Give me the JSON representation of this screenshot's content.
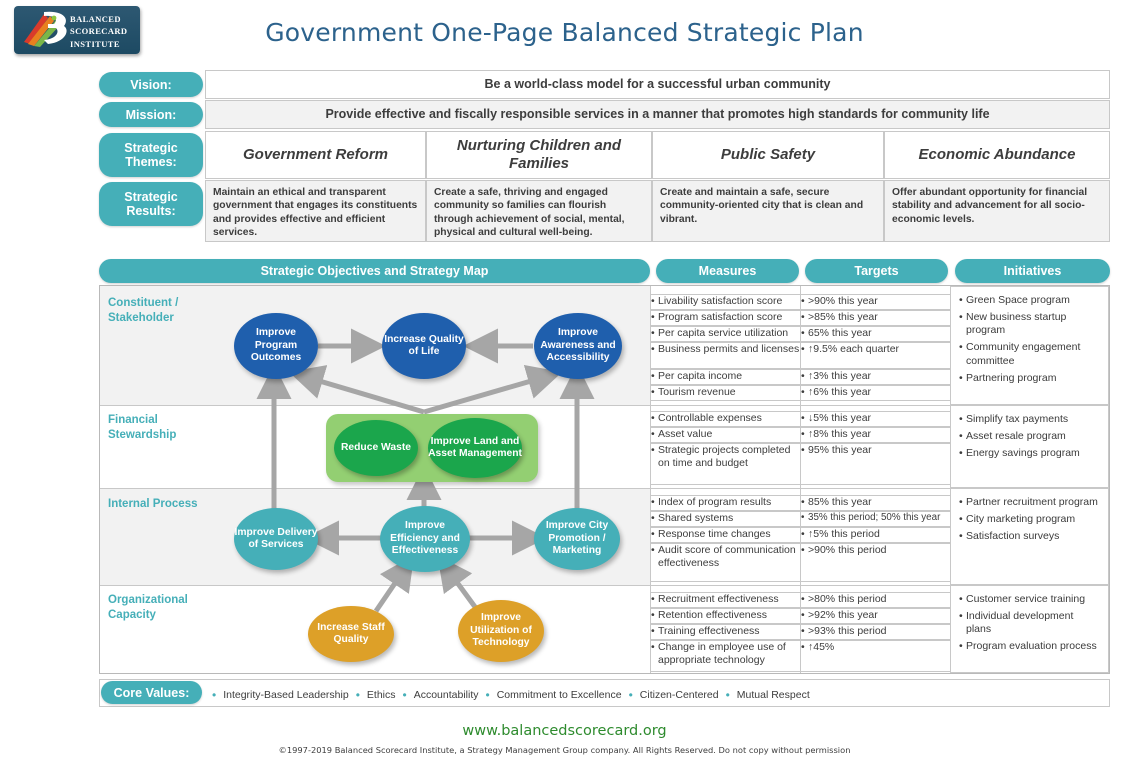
{
  "page": {
    "title": "Government One-Page Balanced Strategic Plan",
    "logo_lines": [
      "BALANCED",
      "SCORECARD",
      "INSTITUTE"
    ],
    "url": "www.balancedscorecard.org",
    "copyright": "©1997-2019 Balanced Scorecard Institute, a Strategy Management Group company. All Rights Reserved. Do not copy without permission"
  },
  "colors": {
    "teal": "#45afb8",
    "title_blue": "#2c628c",
    "blue_oval": "#1f5fad",
    "green_oval": "#1ba64c",
    "green_box": "#93cf72",
    "teal_oval": "#45afb8",
    "orange_oval": "#dda028",
    "url_green": "#2e8b2e"
  },
  "header": {
    "vision_label": "Vision:",
    "vision_text": "Be a world-class model for a successful urban community",
    "mission_label": "Mission:",
    "mission_text": "Provide effective and fiscally responsible services in a manner that promotes high standards for community life",
    "themes_label": "Strategic Themes:",
    "results_label": "Strategic Results:",
    "themes": [
      "Government Reform",
      "Nurturing Children and Families",
      "Public Safety",
      "Economic Abundance"
    ],
    "results": [
      "Maintain an ethical and transparent government that engages its constituents and provides effective and efficient services.",
      "Create a safe, thriving and engaged community so families can flourish through achievement of social, mental, physical and cultural well-being.",
      "Create and maintain a safe, secure community-oriented city that is clean and vibrant.",
      "Offer abundant opportunity for financial stability and advancement for all socio-economic levels."
    ]
  },
  "columns": {
    "strategy_map": "Strategic  Objectives  and  Strategy  Map",
    "measures": "Measures",
    "targets": "Targets",
    "initiatives": "Initiatives"
  },
  "perspectives": [
    {
      "name": "Constituent / Stakeholder",
      "objectives": [
        "Improve Program Outcomes",
        "Increase Quality of Life",
        "Improve Awareness and Accessibility"
      ],
      "measures": [
        "Livability satisfaction score",
        "Program satisfaction score",
        "Per capita service utilization",
        "Business permits and licenses",
        "Per capita income",
        "Tourism revenue"
      ],
      "targets": [
        ">90% this year",
        ">85% this year",
        "65% this year",
        "↑9.5% each quarter",
        "↑3% this year",
        "↑6% this year"
      ],
      "initiatives": [
        "Green Space program",
        "New business startup program",
        "Community engagement committee",
        "Partnering program"
      ]
    },
    {
      "name": "Financial Stewardship",
      "objectives": [
        "Reduce Waste",
        "Improve Land and Asset Management"
      ],
      "measures": [
        "Controllable expenses",
        "Asset value",
        "Strategic projects completed on time and budget"
      ],
      "targets": [
        "↓5% this year",
        "↑8% this year",
        "95% this year"
      ],
      "initiatives": [
        "Simplify tax payments",
        "Asset resale program",
        "Energy savings program"
      ]
    },
    {
      "name": "Internal Process",
      "objectives": [
        "Improve Delivery of Services",
        "Improve Efficiency and Effectiveness",
        "Improve City Promotion / Marketing"
      ],
      "measures": [
        "Index of program results",
        "Shared systems",
        "Response time changes",
        "Audit score of communication effectiveness"
      ],
      "targets": [
        "85% this year",
        "35% this period; 50% this year",
        "↑5% this period",
        ">90% this period"
      ],
      "initiatives": [
        "Partner recruitment program",
        "City marketing program",
        "Satisfaction surveys"
      ]
    },
    {
      "name": "Organizational Capacity",
      "objectives": [
        "Increase Staff Quality",
        "Improve Utilization of Technology"
      ],
      "measures": [
        "Recruitment effectiveness",
        "Retention effectiveness",
        "Training effectiveness",
        "Change in employee use of appropriate technology"
      ],
      "targets": [
        ">80% this period",
        ">92% this year",
        ">93% this period",
        "↑45%"
      ],
      "initiatives": [
        "Customer service training",
        "Individual development plans",
        "Program evaluation process"
      ]
    }
  ],
  "core_values": {
    "label": "Core Values:",
    "items": [
      "Integrity-Based Leadership",
      "Ethics",
      "Accountability",
      "Commitment to Excellence",
      "Citizen-Centered",
      "Mutual Respect"
    ]
  }
}
